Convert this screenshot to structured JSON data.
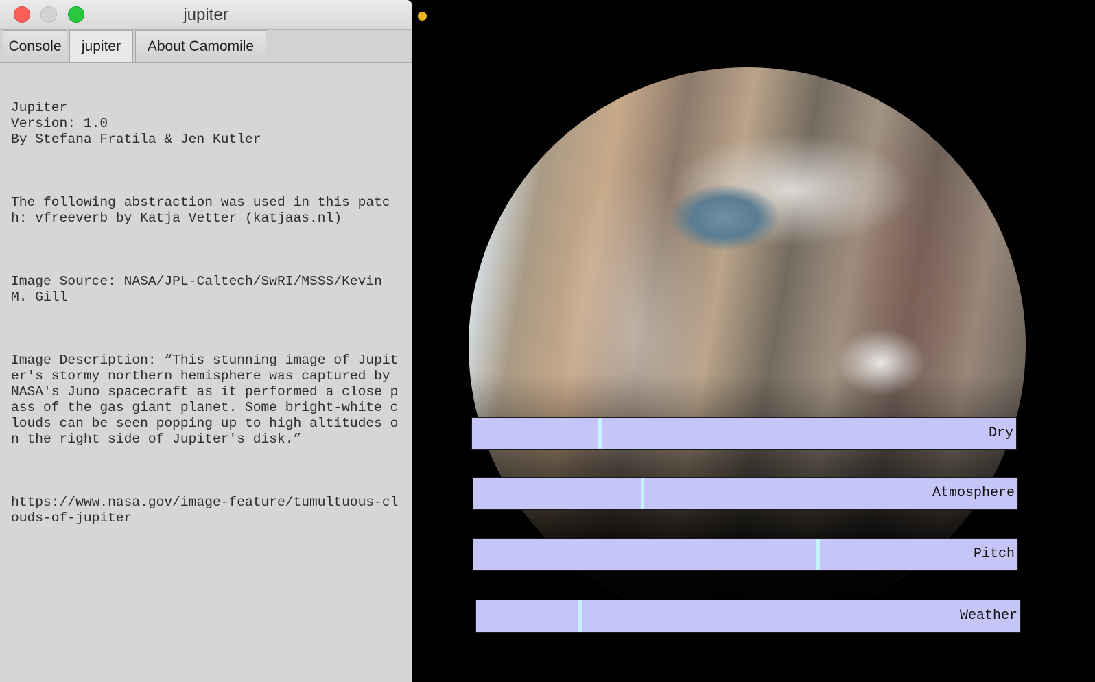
{
  "window": {
    "title": "jupiter",
    "traffic_lights": [
      {
        "name": "close-button",
        "color": "#fe5f57"
      },
      {
        "name": "minimize-button",
        "color": "#d3d3d3"
      },
      {
        "name": "zoom-button",
        "color": "#28c840"
      }
    ]
  },
  "tabs": [
    {
      "label": "Console",
      "active": false
    },
    {
      "label": "jupiter",
      "active": true
    },
    {
      "label": "About Camomile",
      "active": false
    }
  ],
  "info": {
    "name": "Jupiter",
    "version": "Version: 1.0",
    "authors": "By Stefana Fratila & Jen Kutler",
    "abstraction": "The following abstraction was used in this patch: vfreeverb by Katja Vetter (katjaas.nl)",
    "image_source": "Image Source: NASA/JPL-Caltech/SwRI/MSSS/Kevin M. Gill",
    "image_description": "Image Description: “This stunning image of Jupiter's stormy northern hemisphere was captured by NASA's Juno spacecraft as it performed a close pass of the gas giant planet. Some bright-white clouds can be seen popping up to high altitudes on the right side of Jupiter's disk.”",
    "url": "https://www.nasa.gov/image-feature/tumultuous-clouds-of-jupiter"
  },
  "canvas": {
    "background": "#000000",
    "indicator_color": "#e9b422",
    "image": "jupiter-planet-image",
    "slider_color": "#c5c5f7",
    "thumb_color": "#c7f1fb"
  },
  "sliders": [
    {
      "label": "Dry",
      "value": 0.235
    },
    {
      "label": "Atmosphere",
      "value": 0.31
    },
    {
      "label": "Pitch",
      "value": 0.633
    },
    {
      "label": "Weather",
      "value": 0.19
    }
  ]
}
